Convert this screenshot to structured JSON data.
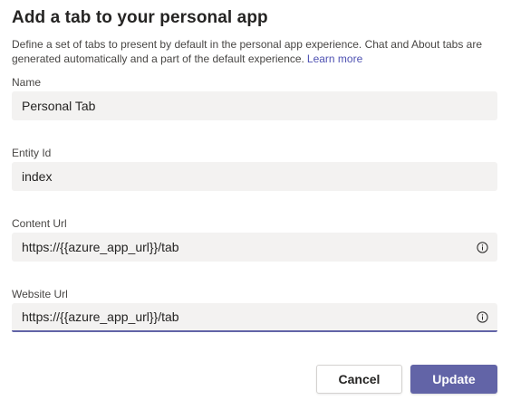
{
  "dialog": {
    "title": "Add a tab to your personal app",
    "description": "Define a set of tabs to present by default in the personal app experience. Chat and About tabs are generated automatically and a part of the default experience.",
    "learn_more": "Learn more"
  },
  "fields": {
    "name": {
      "label": "Name",
      "value": "Personal Tab"
    },
    "entity_id": {
      "label": "Entity Id",
      "value": "index"
    },
    "content_url": {
      "label": "Content Url",
      "value": "https://{{azure_app_url}}/tab",
      "icon": "info-icon"
    },
    "website_url": {
      "label": "Website Url",
      "value": "https://{{azure_app_url}}/tab",
      "icon": "info-icon"
    }
  },
  "buttons": {
    "cancel": "Cancel",
    "update": "Update"
  },
  "colors": {
    "accent": "#6264a7",
    "link": "#4f52b2",
    "field_bg": "#f3f2f1"
  }
}
